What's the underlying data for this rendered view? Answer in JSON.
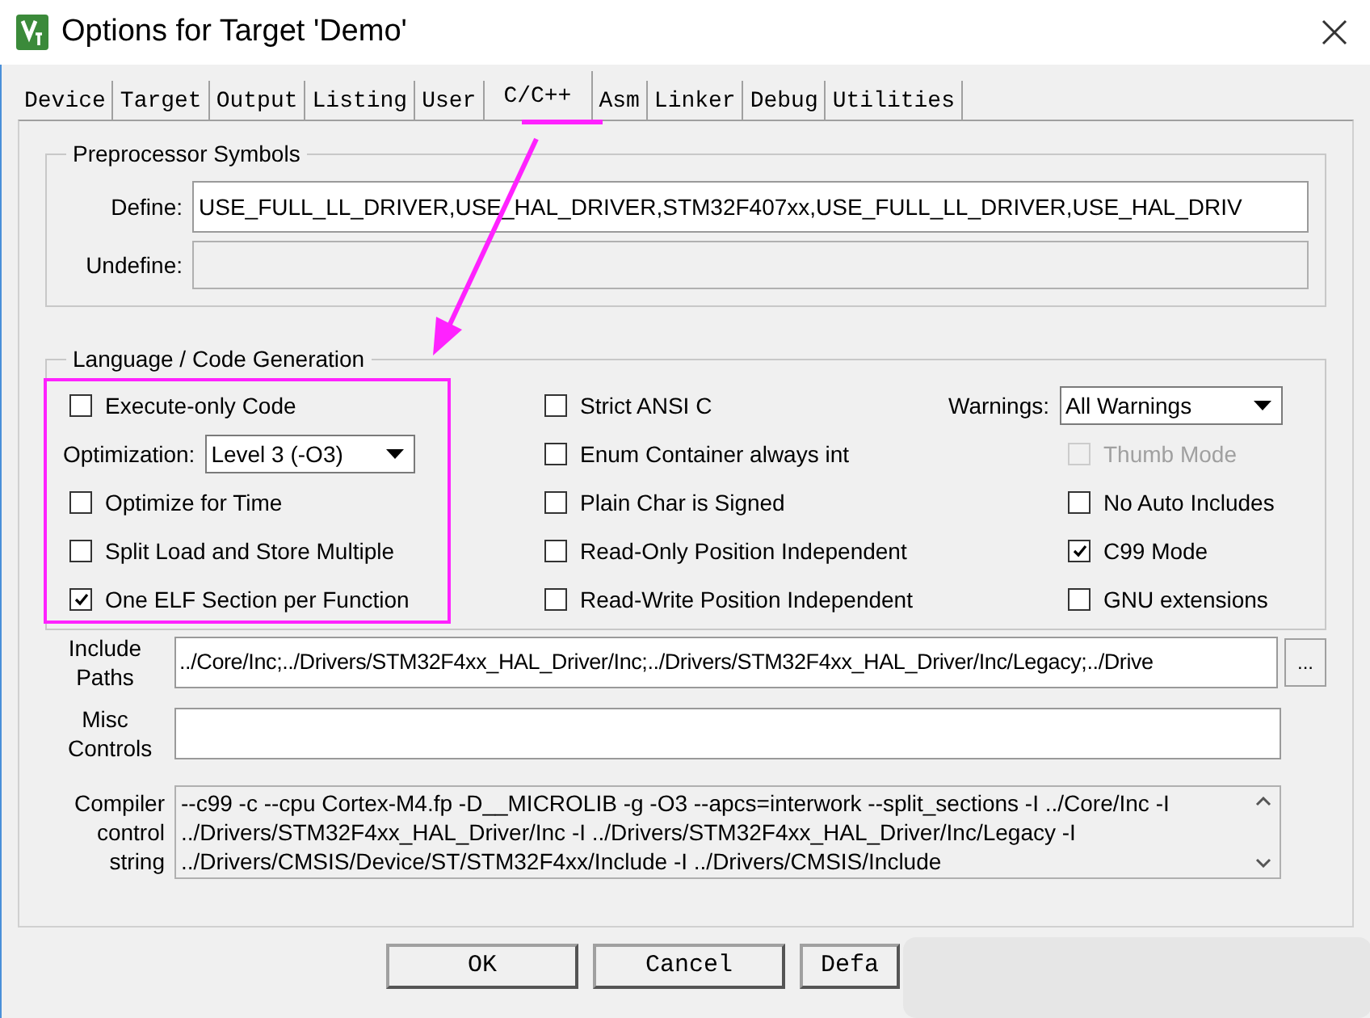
{
  "window": {
    "title": "Options for Target 'Demo'"
  },
  "tabs": [
    {
      "label": "Device",
      "selected": false
    },
    {
      "label": "Target",
      "selected": false
    },
    {
      "label": "Output",
      "selected": false
    },
    {
      "label": "Listing",
      "selected": false
    },
    {
      "label": "User",
      "selected": false
    },
    {
      "label": "C/C++",
      "selected": true
    },
    {
      "label": "Asm",
      "selected": false
    },
    {
      "label": "Linker",
      "selected": false
    },
    {
      "label": "Debug",
      "selected": false
    },
    {
      "label": "Utilities",
      "selected": false
    }
  ],
  "preprocessor": {
    "title": "Preprocessor Symbols",
    "define": {
      "label": "Define:",
      "value": "USE_FULL_LL_DRIVER,USE_HAL_DRIVER,STM32F407xx,USE_FULL_LL_DRIVER,USE_HAL_DRIV"
    },
    "undefine": {
      "label": "Undefine:"
    }
  },
  "language": {
    "title": "Language / Code Generation",
    "columns": [
      [
        {
          "kind": "checkbox",
          "label": "Execute-only Code",
          "checked": false,
          "disabled": false
        },
        {
          "kind": "select",
          "label": "Optimization:",
          "value": "Level 3 (-O3)"
        },
        {
          "kind": "checkbox",
          "label": "Optimize for Time",
          "checked": false,
          "disabled": false
        },
        {
          "kind": "checkbox",
          "label": "Split Load and Store Multiple",
          "checked": false,
          "disabled": false
        },
        {
          "kind": "checkbox",
          "label": "One ELF Section per Function",
          "checked": true,
          "disabled": false
        }
      ],
      [
        {
          "kind": "checkbox",
          "label": "Strict ANSI C",
          "checked": false,
          "disabled": false
        },
        {
          "kind": "checkbox",
          "label": "Enum Container always int",
          "checked": false,
          "disabled": false
        },
        {
          "kind": "checkbox",
          "label": "Plain Char is Signed",
          "checked": false,
          "disabled": false
        },
        {
          "kind": "checkbox",
          "label": "Read-Only Position Independent",
          "checked": false,
          "disabled": false
        },
        {
          "kind": "checkbox",
          "label": "Read-Write Position Independent",
          "checked": false,
          "disabled": false
        }
      ],
      [
        {
          "kind": "select",
          "label": "Warnings:",
          "value": "All Warnings"
        },
        {
          "kind": "checkbox",
          "label": "Thumb Mode",
          "checked": false,
          "disabled": true
        },
        {
          "kind": "checkbox",
          "label": "No Auto Includes",
          "checked": false,
          "disabled": false
        },
        {
          "kind": "checkbox",
          "label": "C99 Mode",
          "checked": true,
          "disabled": false
        },
        {
          "kind": "checkbox",
          "label": "GNU extensions",
          "checked": false,
          "disabled": false
        }
      ]
    ]
  },
  "include_paths": {
    "label": "Include Paths",
    "value": "../Core/Inc;../Drivers/STM32F4xx_HAL_Driver/Inc;../Drivers/STM32F4xx_HAL_Driver/Inc/Legacy;../Drive",
    "browse": "..."
  },
  "misc_controls": {
    "label": "Misc Controls"
  },
  "compiler_string": {
    "label": "Compiler control string",
    "lines": [
      "--c99 -c --cpu Cortex-M4.fp -D__MICROLIB -g -O3 --apcs=interwork --split_sections -I ../Core/Inc -I",
      "../Drivers/STM32F4xx_HAL_Driver/Inc -I ../Drivers/STM32F4xx_HAL_Driver/Inc/Legacy -I",
      "../Drivers/CMSIS/Device/ST/STM32F4xx/Include -I ../Drivers/CMSIS/Include"
    ]
  },
  "buttons": [
    {
      "label": "OK"
    },
    {
      "label": "Cancel"
    },
    {
      "label": "Defa"
    }
  ]
}
